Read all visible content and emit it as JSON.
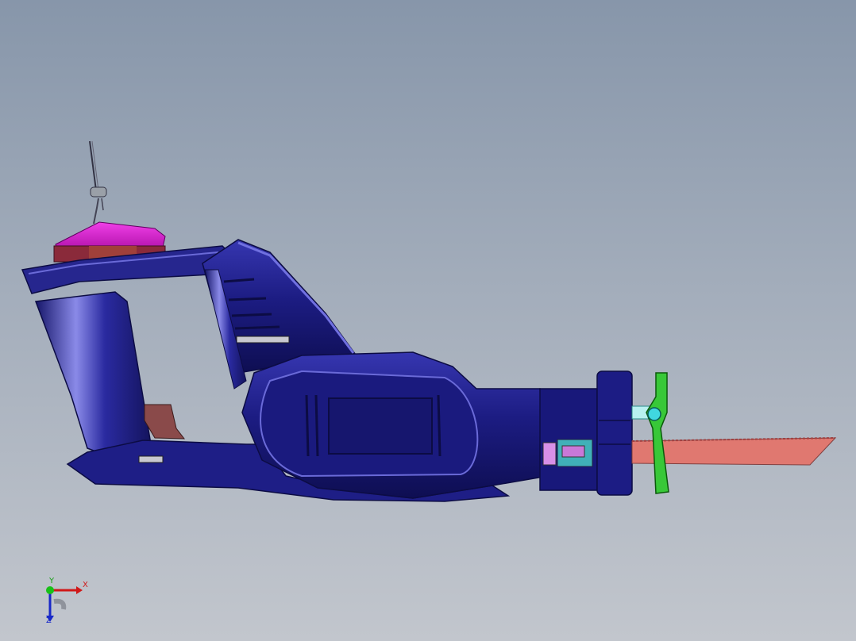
{
  "view": {
    "background_top": "#8796aa",
    "background_bottom": "#c2c6cd",
    "model": {
      "name": "reciprocating-saw",
      "colors": {
        "body": "#1a1a7a",
        "body_highlight": "#5a5ad8",
        "battery_top": "#e020d8",
        "battery_band": "#8a2a3a",
        "trigger": "#8a4a4a",
        "clamp": "#38c838",
        "clamp_pin": "#40d8e0",
        "blade": "#e07870",
        "mechanism": "#d890e8"
      }
    },
    "triad": {
      "x_label": "X",
      "y_label": "Y",
      "z_label": "Z",
      "x_color": "#d01818",
      "y_color": "#18a018",
      "z_color": "#1828c8"
    }
  }
}
